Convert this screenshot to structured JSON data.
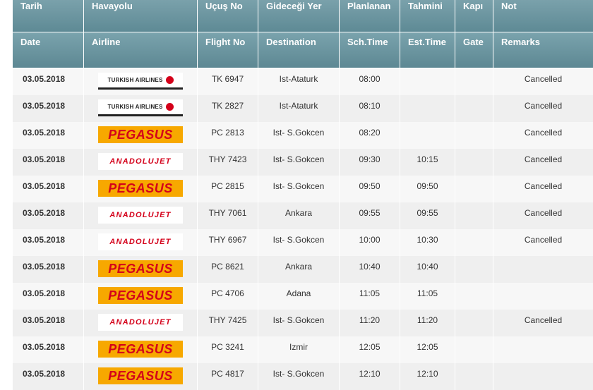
{
  "header_tr": {
    "date": "Tarih",
    "airline": "Havayolu",
    "flight_no": "Uçuş No",
    "destination": "Gideceği Yer",
    "sch_time": "Planlanan",
    "est_time": "Tahmini",
    "gate": "Kapı",
    "remarks": "Not"
  },
  "header_en": {
    "date": "Date",
    "airline": "Airline",
    "flight_no": "Flight No",
    "destination": "Destination",
    "sch_time": "Sch.Time",
    "est_time": "Est.Time",
    "gate": "Gate",
    "remarks": "Remarks"
  },
  "logos": {
    "thy": "TURKISH AIRLINES",
    "pgs": "PEGASUS",
    "aj": "ANADOLUJET"
  },
  "colors": {
    "header_bg": "#6c959f",
    "logo_red": "#d4001a",
    "pegasus_yellow": "#f7a800"
  },
  "flights": [
    {
      "date": "03.05.2018",
      "airline": "thy",
      "flight_no": "TK  6947",
      "destination": "Ist-Ataturk",
      "sch_time": "08:00",
      "est_time": "",
      "gate": "",
      "remarks": "Cancelled"
    },
    {
      "date": "03.05.2018",
      "airline": "thy",
      "flight_no": "TK  2827",
      "destination": "Ist-Ataturk",
      "sch_time": "08:10",
      "est_time": "",
      "gate": "",
      "remarks": "Cancelled"
    },
    {
      "date": "03.05.2018",
      "airline": "pgs",
      "flight_no": "PC  2813",
      "destination": "Ist- S.Gokcen",
      "sch_time": "08:20",
      "est_time": "",
      "gate": "",
      "remarks": "Cancelled"
    },
    {
      "date": "03.05.2018",
      "airline": "aj",
      "flight_no": "THY 7423",
      "destination": "Ist- S.Gokcen",
      "sch_time": "09:30",
      "est_time": "10:15",
      "gate": "",
      "remarks": "Cancelled"
    },
    {
      "date": "03.05.2018",
      "airline": "pgs",
      "flight_no": "PC  2815",
      "destination": "Ist- S.Gokcen",
      "sch_time": "09:50",
      "est_time": "09:50",
      "gate": "",
      "remarks": "Cancelled"
    },
    {
      "date": "03.05.2018",
      "airline": "aj",
      "flight_no": "THY 7061",
      "destination": "Ankara",
      "sch_time": "09:55",
      "est_time": "09:55",
      "gate": "",
      "remarks": "Cancelled"
    },
    {
      "date": "03.05.2018",
      "airline": "aj",
      "flight_no": "THY 6967",
      "destination": "Ist- S.Gokcen",
      "sch_time": "10:00",
      "est_time": "10:30",
      "gate": "",
      "remarks": "Cancelled"
    },
    {
      "date": "03.05.2018",
      "airline": "pgs",
      "flight_no": "PC  8621",
      "destination": "Ankara",
      "sch_time": "10:40",
      "est_time": "10:40",
      "gate": "",
      "remarks": ""
    },
    {
      "date": "03.05.2018",
      "airline": "pgs",
      "flight_no": "PC  4706",
      "destination": "Adana",
      "sch_time": "11:05",
      "est_time": "11:05",
      "gate": "",
      "remarks": ""
    },
    {
      "date": "03.05.2018",
      "airline": "aj",
      "flight_no": "THY 7425",
      "destination": "Ist- S.Gokcen",
      "sch_time": "11:20",
      "est_time": "11:20",
      "gate": "",
      "remarks": "Cancelled"
    },
    {
      "date": "03.05.2018",
      "airline": "pgs",
      "flight_no": "PC  3241",
      "destination": "Izmir",
      "sch_time": "12:05",
      "est_time": "12:05",
      "gate": "",
      "remarks": ""
    },
    {
      "date": "03.05.2018",
      "airline": "pgs",
      "flight_no": "PC  4817",
      "destination": "Ist- S.Gokcen",
      "sch_time": "12:10",
      "est_time": "12:10",
      "gate": "",
      "remarks": ""
    }
  ]
}
